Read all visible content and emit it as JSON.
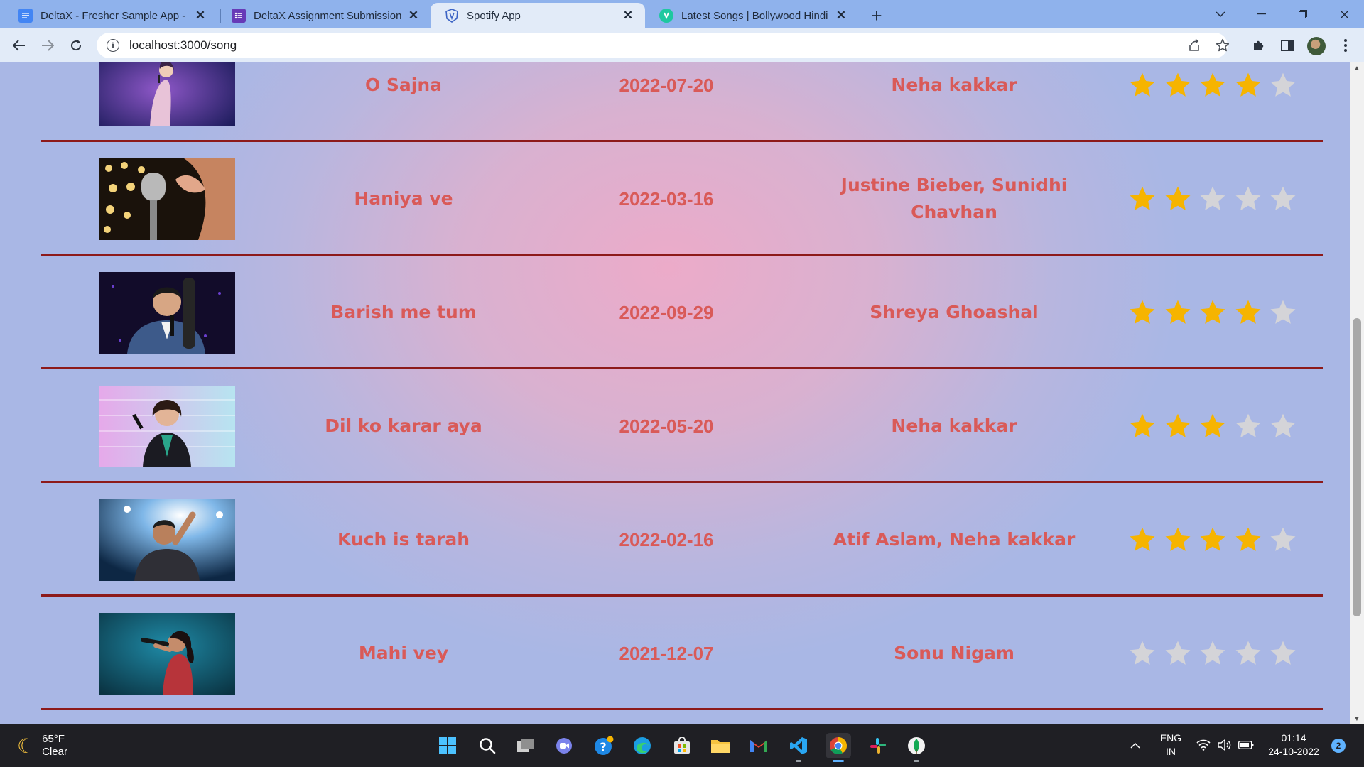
{
  "browser": {
    "tabs": [
      {
        "title": "DeltaX - Fresher Sample App - Sp",
        "icon": "google-docs-icon",
        "active": false
      },
      {
        "title": "DeltaX Assignment Submission -",
        "icon": "google-forms-icon",
        "active": false
      },
      {
        "title": "Spotify App",
        "icon": "react-app-icon",
        "active": true
      },
      {
        "title": "Latest Songs | Bollywood Hindi T",
        "icon": "music-site-icon",
        "active": false
      }
    ],
    "url": "localhost:3000/song"
  },
  "songs": [
    {
      "title": "O Sajna",
      "release_date": "2022-07-20",
      "artists": "Neha kakkar",
      "rating": 4,
      "artwork": "singer-on-stage-purple"
    },
    {
      "title": "Haniya ve",
      "release_date": "2022-03-16",
      "artists": "Justine Bieber, Sunidhi Chavhan",
      "rating": 2,
      "artwork": "vintage-microphone"
    },
    {
      "title": "Barish me tum",
      "release_date": "2022-09-29",
      "artists": "Shreya Ghoashal",
      "rating": 4,
      "artwork": "singer-in-suit"
    },
    {
      "title": "Dil ko karar aya",
      "release_date": "2022-05-20",
      "artists": "Neha kakkar",
      "rating": 3,
      "artwork": "singer-brick-wall"
    },
    {
      "title": "Kuch is tarah",
      "release_date": "2022-02-16",
      "artists": "Atif Aslam, Neha kakkar",
      "rating": 4,
      "artwork": "singer-concert-lights"
    },
    {
      "title": "Mahi vey",
      "release_date": "2021-12-07",
      "artists": "Sonu Nigam",
      "rating": 0,
      "artwork": "singer-teal-stage"
    }
  ],
  "max_rating": 5,
  "colors": {
    "text": "#d95a58",
    "divider": "#8d1a1a",
    "star_filled": "#f6b400",
    "star_empty": "#d4d4d8"
  },
  "taskbar": {
    "weather_temp": "65°F",
    "weather_desc": "Clear",
    "lang_top": "ENG",
    "lang_bottom": "IN",
    "time": "01:14",
    "date": "24-10-2022",
    "notifications": "2"
  }
}
